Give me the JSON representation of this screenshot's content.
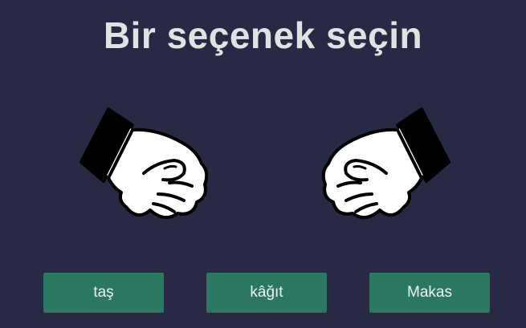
{
  "game": {
    "title": "Bir seçenek seçin"
  },
  "hands": {
    "player": {
      "icon": "fist-icon",
      "state": "rock"
    },
    "computer": {
      "icon": "fist-icon",
      "state": "rock"
    }
  },
  "choices": [
    {
      "label": "taş"
    },
    {
      "label": "kâğıt"
    },
    {
      "label": "Makas"
    }
  ],
  "colors": {
    "background": "#272945",
    "title": "#e2e2e4",
    "button": "#2b7761",
    "button_text": "#eef3f1"
  }
}
